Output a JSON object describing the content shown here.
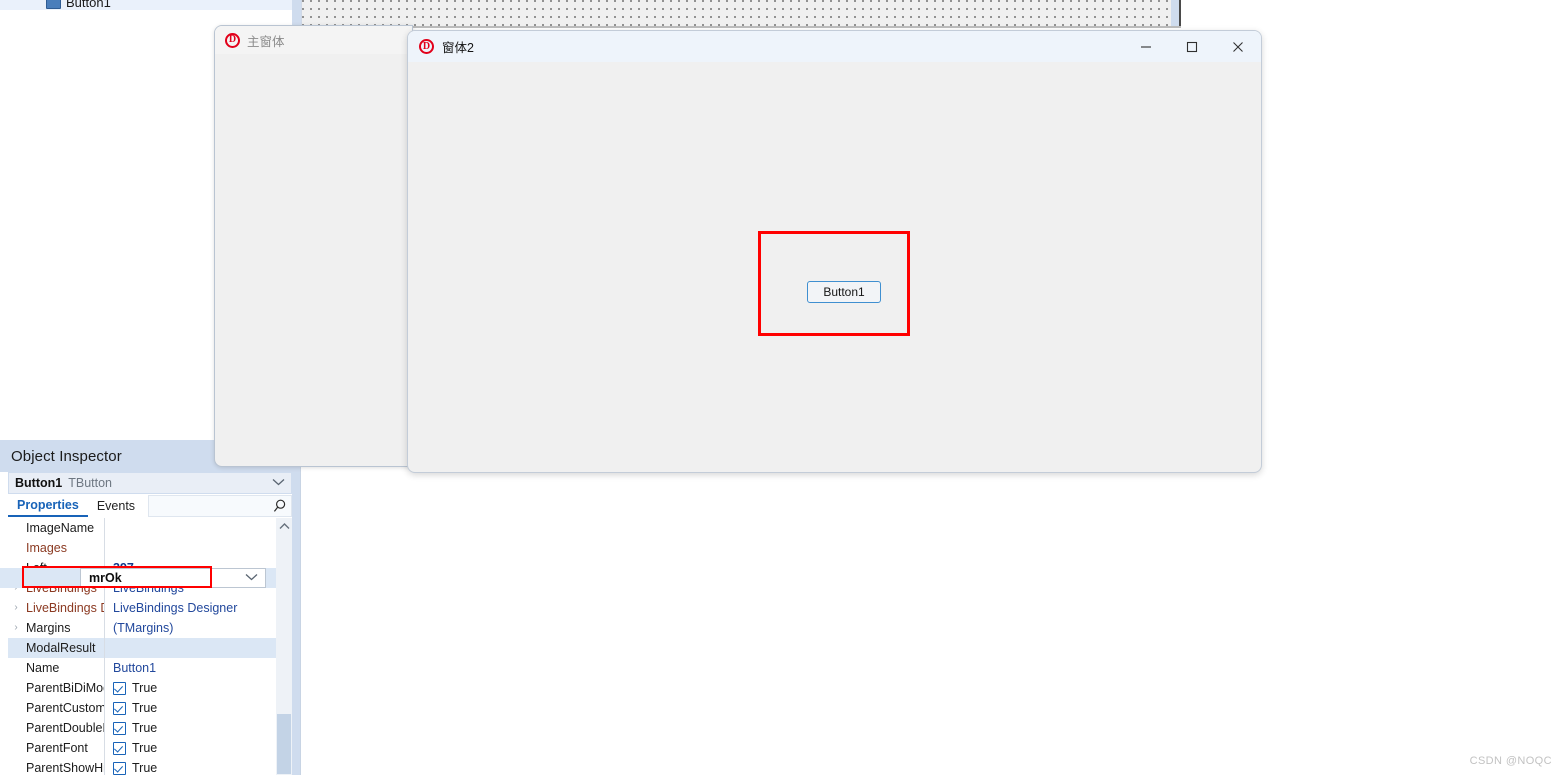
{
  "ide": {
    "structure": {
      "tree_item_label": "Button1",
      "tree_item_icon": "component-icon"
    },
    "object_inspector": {
      "panel_title": "Object Inspector",
      "object_name": "Button1",
      "object_type": "TButton",
      "dropdown_icon": "chevron-down-icon",
      "tabs": [
        {
          "label": "Properties",
          "active": true
        },
        {
          "label": "Events",
          "active": false
        }
      ],
      "search": {
        "value": "",
        "placeholder": "",
        "icon": "search-icon"
      },
      "scrollbar": {
        "up_icon": "chevron-up-icon"
      },
      "properties": [
        {
          "name": "ImageName",
          "value": "",
          "kind": "text",
          "expandable": false,
          "name_color": "default"
        },
        {
          "name": "Images",
          "value": "",
          "kind": "text",
          "expandable": false,
          "name_color": "accent"
        },
        {
          "name": "Left",
          "value": "397",
          "kind": "bold",
          "expandable": false,
          "name_color": "default"
        },
        {
          "name": "LiveBindings",
          "value": "LiveBindings",
          "kind": "text",
          "expandable": true,
          "name_color": "accent"
        },
        {
          "name": "LiveBindings D",
          "value": "LiveBindings Designer",
          "kind": "text",
          "expandable": true,
          "name_color": "accent"
        },
        {
          "name": "Margins",
          "value": "(TMargins)",
          "kind": "text",
          "expandable": true,
          "name_color": "default"
        },
        {
          "name": "ModalResult",
          "value": "mrOk",
          "kind": "combo",
          "expandable": false,
          "name_color": "default"
        },
        {
          "name": "Name",
          "value": "Button1",
          "kind": "text",
          "expandable": false,
          "name_color": "default"
        },
        {
          "name": "ParentBiDiMode",
          "value": "True",
          "kind": "checkbox",
          "expandable": false,
          "name_color": "default"
        },
        {
          "name": "ParentCustomHint",
          "value": "True",
          "kind": "checkbox",
          "expandable": false,
          "name_color": "default"
        },
        {
          "name": "ParentDoubleBuffered",
          "value": "True",
          "kind": "checkbox",
          "expandable": false,
          "name_color": "default"
        },
        {
          "name": "ParentFont",
          "value": "True",
          "kind": "checkbox",
          "expandable": false,
          "name_color": "default"
        },
        {
          "name": "ParentShowHint",
          "value": "True",
          "kind": "checkbox",
          "expandable": false,
          "name_color": "default"
        }
      ],
      "selected_property": "ModalResult",
      "selected_value": "mrOk",
      "combo_icon": "chevron-down-icon"
    }
  },
  "windows": {
    "main_form": {
      "title": "主窗体",
      "icon": "delphi-logo-icon",
      "active": false
    },
    "form2": {
      "title": "窗体2",
      "icon": "delphi-logo-icon",
      "active": true,
      "caption_buttons": [
        {
          "name": "minimize",
          "glyph": "—"
        },
        {
          "name": "maximize",
          "glyph": "▢"
        },
        {
          "name": "close",
          "glyph": "✕"
        }
      ],
      "button": {
        "caption": "Button1"
      }
    }
  },
  "annotations": {
    "highlight_color": "#ff0000",
    "targets": [
      "ModalResult property row",
      "Button1 on 窗体2"
    ]
  },
  "watermark": "CSDN @NOQC"
}
